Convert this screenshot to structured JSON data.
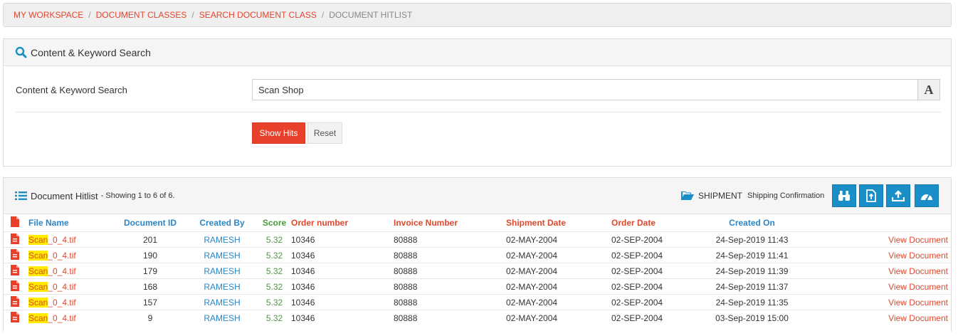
{
  "breadcrumb": {
    "items": [
      "MY WORKSPACE",
      "DOCUMENT CLASSES",
      "SEARCH DOCUMENT CLASS"
    ],
    "current": "DOCUMENT HITLIST",
    "separator": "/"
  },
  "search": {
    "title": "Content & Keyword Search",
    "field_label": "Content & Keyword Search",
    "value": "Scan Shop",
    "font_button": "A",
    "show_hits_label": "Show Hits",
    "reset_label": "Reset"
  },
  "hitlist": {
    "title": "Document Hitlist",
    "showing": "- Showing 1 to 6 of 6.",
    "class_name": "SHIPMENT",
    "class_sub": "Shipping Confirmation",
    "toolbar_icons": [
      "binoculars-icon",
      "export-file-icon",
      "upload-icon",
      "dashboard-icon"
    ],
    "columns": {
      "file_name": "File Name",
      "document_id": "Document ID",
      "created_by": "Created By",
      "score": "Score",
      "order_number": "Order number",
      "invoice_number": "Invoice Number",
      "shipment_date": "Shipment Date",
      "order_date": "Order Date",
      "created_on": "Created On"
    },
    "highlight_term": "Scan",
    "view_label": "View Document",
    "rows": [
      {
        "file_prefix": "Scan",
        "file_rest": "_0_4.tif",
        "document_id": "201",
        "created_by": "RAMESH",
        "score": "5.32",
        "order_number": "10346",
        "invoice_number": "80888",
        "shipment_date": "02-MAY-2004",
        "order_date": "02-SEP-2004",
        "created_on": "24-Sep-2019 11:43",
        "action": "View Document"
      },
      {
        "file_prefix": "Scan",
        "file_rest": "_0_4.tif",
        "document_id": "190",
        "created_by": "RAMESH",
        "score": "5.32",
        "order_number": "10346",
        "invoice_number": "80888",
        "shipment_date": "02-MAY-2004",
        "order_date": "02-SEP-2004",
        "created_on": "24-Sep-2019 11:41",
        "action": "View Document"
      },
      {
        "file_prefix": "Scan",
        "file_rest": "_0_4.tif",
        "document_id": "179",
        "created_by": "RAMESH",
        "score": "5.32",
        "order_number": "10346",
        "invoice_number": "80888",
        "shipment_date": "02-MAY-2004",
        "order_date": "02-SEP-2004",
        "created_on": "24-Sep-2019 11:39",
        "action": "View Document"
      },
      {
        "file_prefix": "Scan",
        "file_rest": "_0_4.tif",
        "document_id": "168",
        "created_by": "RAMESH",
        "score": "5.32",
        "order_number": "10346",
        "invoice_number": "80888",
        "shipment_date": "02-MAY-2004",
        "order_date": "02-SEP-2004",
        "created_on": "24-Sep-2019 11:37",
        "action": "View Document"
      },
      {
        "file_prefix": "Scan",
        "file_rest": "_0_4.tif",
        "document_id": "157",
        "created_by": "RAMESH",
        "score": "5.32",
        "order_number": "10346",
        "invoice_number": "80888",
        "shipment_date": "02-MAY-2004",
        "order_date": "02-SEP-2004",
        "created_on": "24-Sep-2019 11:35",
        "action": "View Document"
      },
      {
        "file_prefix": "Scan",
        "file_rest": "_0_4.tif",
        "document_id": "9",
        "created_by": "RAMESH",
        "score": "5.32",
        "order_number": "10346",
        "invoice_number": "80888",
        "shipment_date": "02-MAY-2004",
        "order_date": "02-SEP-2004",
        "created_on": "03-Sep-2019 15:00",
        "action": "View Document"
      }
    ]
  },
  "colors": {
    "accent_red": "#e8402a",
    "link_blue": "#2a86c7",
    "score_green": "#4a9a3c",
    "button_blue": "#1a8fc7",
    "highlight_yellow": "#ffea00"
  }
}
